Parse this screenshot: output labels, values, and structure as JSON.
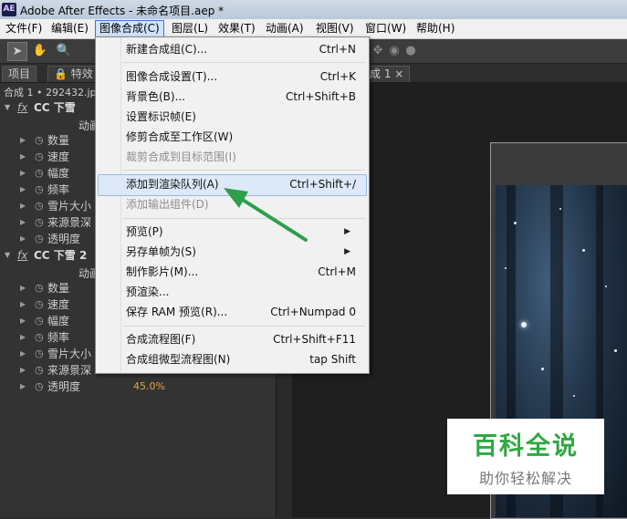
{
  "window": {
    "icon_text": "AE",
    "title": "Adobe After Effects - 未命名项目.aep *"
  },
  "menubar": [
    "文件(F)",
    "编辑(E)",
    "图像合成(C)",
    "图层(L)",
    "效果(T)",
    "动画(A)",
    "视图(V)",
    "窗口(W)",
    "帮助(H)"
  ],
  "panel_tabs": {
    "project": "项目",
    "effects": "特效",
    "comp_tab": "成 1",
    "comp_close": "×",
    "comp_label": "合成 1 • 292432.jp"
  },
  "effects": [
    {
      "name": "CC 下雪",
      "anim": "动画",
      "props": [
        {
          "label": "数量",
          "value": ""
        },
        {
          "label": "速度",
          "value": ""
        },
        {
          "label": "幅度",
          "value": ""
        },
        {
          "label": "频率",
          "value": ""
        },
        {
          "label": "雪片大小",
          "value": ""
        },
        {
          "label": "来源景深",
          "value": ""
        },
        {
          "label": "透明度",
          "value": ""
        }
      ]
    },
    {
      "name": "CC 下雪 2",
      "anim": "动画",
      "props": [
        {
          "label": "数量",
          "value": ""
        },
        {
          "label": "速度",
          "value": ""
        },
        {
          "label": "幅度",
          "value": ""
        },
        {
          "label": "频率",
          "value": ""
        },
        {
          "label": "雪片大小",
          "value": ""
        },
        {
          "label": "来源景深",
          "value": ""
        },
        {
          "label": "透明度",
          "value": "45.0%"
        }
      ]
    }
  ],
  "fx_label": "fx",
  "dropdown": {
    "items": [
      {
        "label": "新建合成组(C)...",
        "shortcut": "Ctrl+N",
        "disabled": false
      },
      {
        "label": "图像合成设置(T)...",
        "shortcut": "Ctrl+K",
        "disabled": false
      },
      {
        "label": "背景色(B)...",
        "shortcut": "Ctrl+Shift+B",
        "disabled": false
      },
      {
        "label": "设置标识帧(E)",
        "shortcut": "",
        "disabled": false
      },
      {
        "label": "修剪合成至工作区(W)",
        "shortcut": "",
        "disabled": false
      },
      {
        "label": "裁剪合成到目标范围(I)",
        "shortcut": "",
        "disabled": true
      },
      {
        "label": "添加到渲染队列(A)",
        "shortcut": "Ctrl+Shift+/",
        "disabled": false
      },
      {
        "label": "添加输出组件(D)",
        "shortcut": "",
        "disabled": true
      },
      {
        "label": "预览(P)",
        "shortcut": "",
        "disabled": false,
        "submenu": true
      },
      {
        "label": "另存单帧为(S)",
        "shortcut": "",
        "disabled": false,
        "submenu": true
      },
      {
        "label": "制作影片(M)...",
        "shortcut": "Ctrl+M",
        "disabled": false
      },
      {
        "label": "预渲染...",
        "shortcut": "",
        "disabled": false
      },
      {
        "label": "保存 RAM 预览(R)...",
        "shortcut": "Ctrl+Numpad 0",
        "disabled": false
      },
      {
        "label": "合成流程图(F)",
        "shortcut": "Ctrl+Shift+F11",
        "disabled": false
      },
      {
        "label": "合成组微型流程图(N)",
        "shortcut": "tap Shift",
        "disabled": false
      }
    ],
    "highlighted_index": 6
  },
  "watermark": {
    "title": "百科全说",
    "subtitle": "助你轻松解决"
  },
  "colors": {
    "value_orange": "#e8a33a",
    "arrow_green": "#2e9e4a",
    "watermark_green": "#2fa842"
  }
}
